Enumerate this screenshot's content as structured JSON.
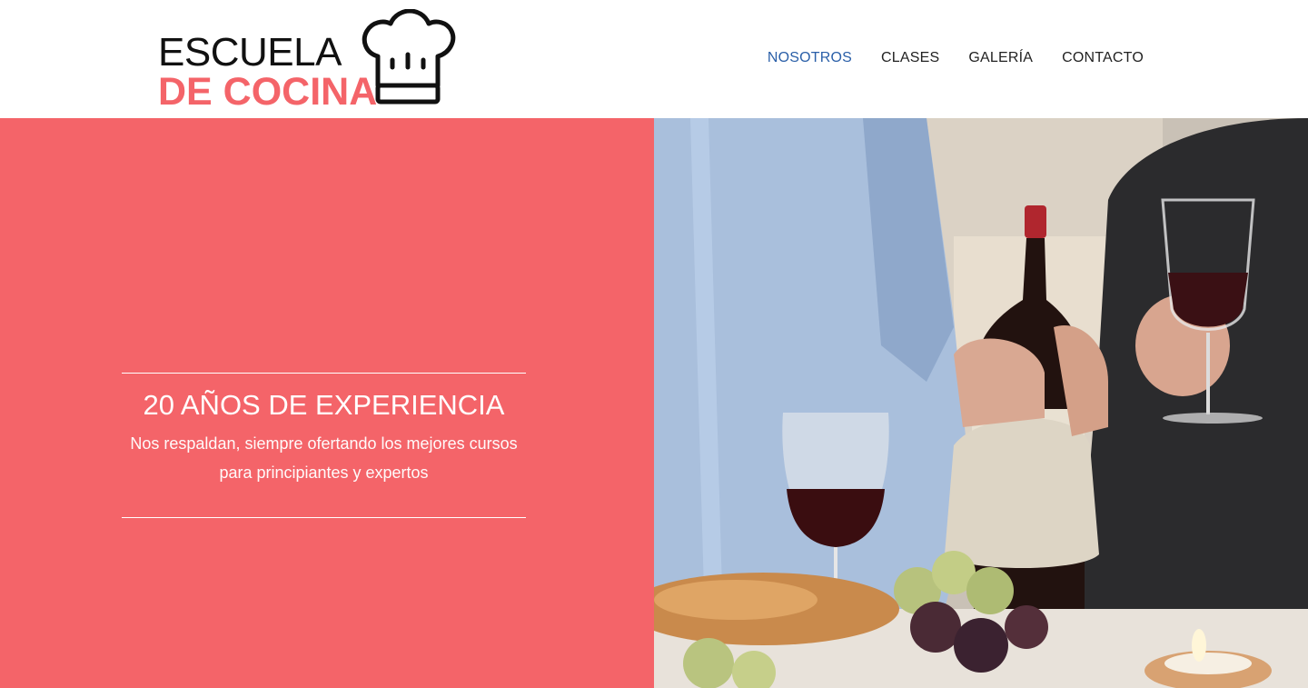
{
  "logo": {
    "line1": "ESCUELA",
    "line2": "DE COCINA",
    "icon": "chef-hat-icon",
    "accent_color": "#f46469"
  },
  "nav": {
    "items": [
      {
        "label": "NOSOTROS",
        "active": true
      },
      {
        "label": "CLASES",
        "active": false
      },
      {
        "label": "GALERÍA",
        "active": false
      },
      {
        "label": "CONTACTO",
        "active": false
      }
    ],
    "active_color": "#2a5fa8"
  },
  "hero": {
    "title": "20 AÑOS DE EXPERIENCIA",
    "subtitle": "Nos respaldan, siempre ofertando los mejores cursos para principiantes y expertos",
    "background_color": "#f46469",
    "image": "wine-dinner-photo"
  }
}
